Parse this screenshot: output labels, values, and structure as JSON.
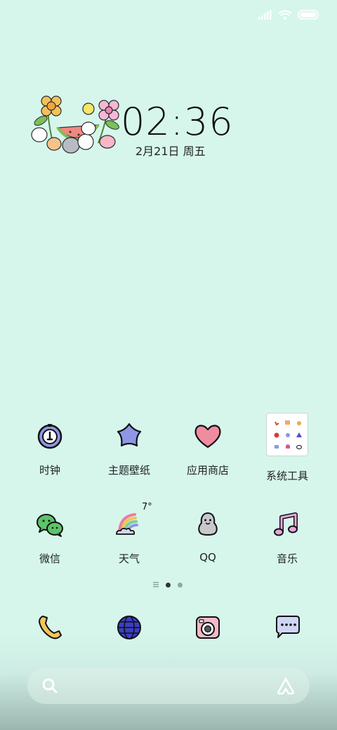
{
  "clock": {
    "time": "02:36",
    "date": "2月21日 周五"
  },
  "apps_row1": [
    {
      "label": "时钟",
      "icon": "clock-icon"
    },
    {
      "label": "主题壁纸",
      "icon": "star-flower-icon"
    },
    {
      "label": "应用商店",
      "icon": "heart-icon"
    },
    {
      "label": "系统工具",
      "icon": "folder-icon"
    }
  ],
  "apps_row2": [
    {
      "label": "微信",
      "icon": "wechat-icon"
    },
    {
      "label": "天气",
      "icon": "rainbow-cloud-icon",
      "badge": "7°"
    },
    {
      "label": "QQ",
      "icon": "penguin-icon"
    },
    {
      "label": "音乐",
      "icon": "music-note-icon"
    }
  ],
  "dock": [
    "phone-icon",
    "browser-globe-icon",
    "camera-icon",
    "messages-icon"
  ],
  "page_indicator": {
    "pages": 2,
    "current": 1
  },
  "colors": {
    "background": "#d6f6ec",
    "accent_blue": "#8e97e6",
    "heart_pink": "#f08ca0",
    "globe_blue": "#3a3fc4"
  }
}
